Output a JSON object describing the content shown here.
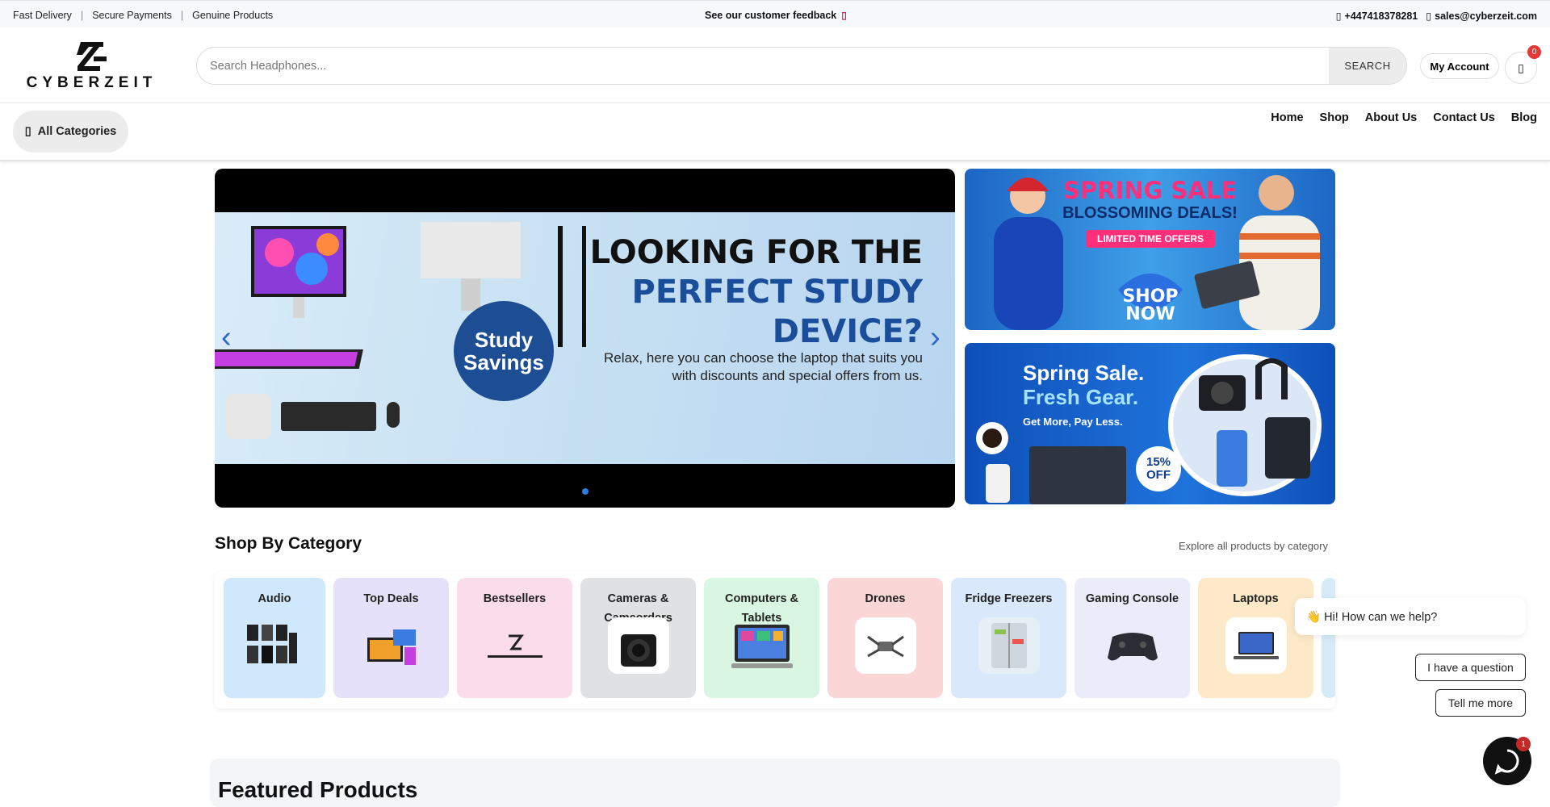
{
  "topbar": {
    "left_items": [
      "Fast Delivery",
      "Secure Payments",
      "Genuine Products"
    ],
    "separator": "|",
    "feedback": "See our customer feedback",
    "phone": "+447418378281",
    "email": "sales@cyberzeit.com"
  },
  "header": {
    "logo_text": "CYBERZEIT",
    "search_placeholder": "Search Headphones...",
    "search_button": "SEARCH",
    "account_label": "My Account",
    "cart_count": "0"
  },
  "nav": {
    "all_categories": "All Categories",
    "links": [
      "Home",
      "Shop",
      "About Us",
      "Contact Us",
      "Blog"
    ]
  },
  "hero": {
    "line1": "LOOKING FOR THE",
    "line2": "PERFECT STUDY",
    "line3": "DEVICE?",
    "subtitle": "Relax, here you can choose the laptop that suits you with discounts and special offers from us.",
    "circle_line1": "Study",
    "circle_line2": "Savings"
  },
  "promo1": {
    "title": "SPRING SALE",
    "subtitle": "BLOSSOMING DEALS!",
    "badge": "LIMITED TIME OFFERS",
    "shop_line1": "SHOP",
    "shop_line2": "NOW"
  },
  "promo2": {
    "title_line1": "Spring Sale.",
    "title_line2": "Fresh Gear.",
    "subtitle": "Get More, Pay Less.",
    "discount_line1": "15%",
    "discount_line2": "OFF"
  },
  "categories": {
    "title": "Shop By Category",
    "explore": "Explore all products by category",
    "items": [
      {
        "name": "Audio",
        "color": "#cfe8fb"
      },
      {
        "name": "Top Deals",
        "color": "#e6e1fb"
      },
      {
        "name": "Bestsellers",
        "color": "#fbdcea"
      },
      {
        "name": "Cameras & Camcorders",
        "color": "#e0e1e3"
      },
      {
        "name": "Computers & Tablets",
        "color": "#d8f6e1"
      },
      {
        "name": "Drones",
        "color": "#fbd6d6"
      },
      {
        "name": "Fridge Freezers",
        "color": "#d9e8fa"
      },
      {
        "name": "Gaming Console",
        "color": "#ebecfa"
      },
      {
        "name": "Laptops",
        "color": "#fde8c7"
      }
    ]
  },
  "featured": {
    "title": "Featured Products"
  },
  "chat": {
    "greeting": "👋 Hi! How can we help?",
    "option1": "I have a question",
    "option2": "Tell me more",
    "badge": "1"
  }
}
